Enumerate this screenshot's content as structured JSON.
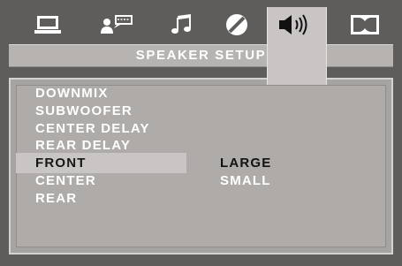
{
  "title": "SPEAKER SETUP",
  "tabs": [
    {
      "icon": "monitor-icon"
    },
    {
      "icon": "language-icon"
    },
    {
      "icon": "music-note-icon"
    },
    {
      "icon": "disc-icon"
    },
    {
      "icon": "speaker-icon",
      "active": true
    },
    {
      "icon": "dolby-icon"
    }
  ],
  "menu": [
    {
      "label": "DOWNMIX"
    },
    {
      "label": "SUBWOOFER"
    },
    {
      "label": "CENTER DELAY"
    },
    {
      "label": "REAR DELAY"
    },
    {
      "label": "FRONT",
      "selected": true
    },
    {
      "label": "CENTER"
    },
    {
      "label": "REAR"
    }
  ],
  "options": [
    {
      "label": "LARGE",
      "selected": true
    },
    {
      "label": "SMALL"
    }
  ],
  "colors": {
    "background": "#5f5d5c",
    "panel": "#aeaba9",
    "highlight": "#c8c5c4",
    "text": "#ffffff"
  }
}
